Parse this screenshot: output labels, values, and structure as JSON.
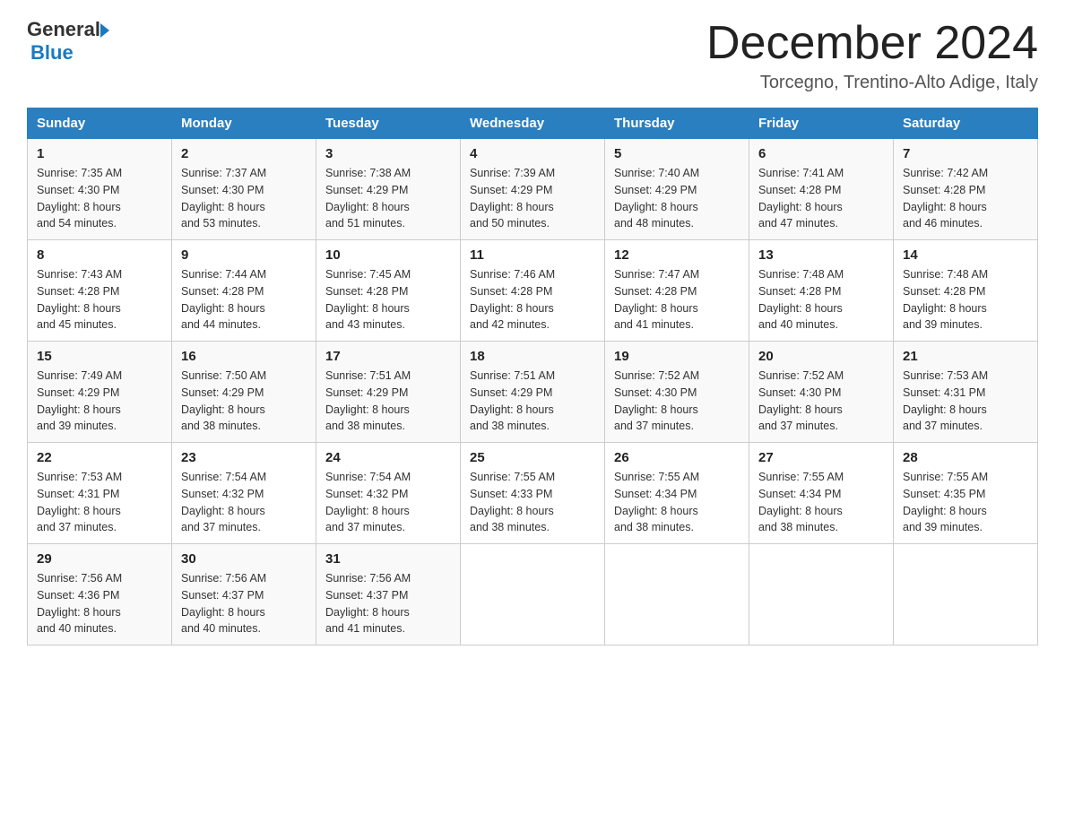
{
  "header": {
    "logo_general": "General",
    "logo_blue": "Blue",
    "month_title": "December 2024",
    "location": "Torcegno, Trentino-Alto Adige, Italy"
  },
  "days_of_week": [
    "Sunday",
    "Monday",
    "Tuesday",
    "Wednesday",
    "Thursday",
    "Friday",
    "Saturday"
  ],
  "weeks": [
    [
      {
        "day": "1",
        "sunrise": "7:35 AM",
        "sunset": "4:30 PM",
        "daylight": "8 hours and 54 minutes."
      },
      {
        "day": "2",
        "sunrise": "7:37 AM",
        "sunset": "4:30 PM",
        "daylight": "8 hours and 53 minutes."
      },
      {
        "day": "3",
        "sunrise": "7:38 AM",
        "sunset": "4:29 PM",
        "daylight": "8 hours and 51 minutes."
      },
      {
        "day": "4",
        "sunrise": "7:39 AM",
        "sunset": "4:29 PM",
        "daylight": "8 hours and 50 minutes."
      },
      {
        "day": "5",
        "sunrise": "7:40 AM",
        "sunset": "4:29 PM",
        "daylight": "8 hours and 48 minutes."
      },
      {
        "day": "6",
        "sunrise": "7:41 AM",
        "sunset": "4:28 PM",
        "daylight": "8 hours and 47 minutes."
      },
      {
        "day": "7",
        "sunrise": "7:42 AM",
        "sunset": "4:28 PM",
        "daylight": "8 hours and 46 minutes."
      }
    ],
    [
      {
        "day": "8",
        "sunrise": "7:43 AM",
        "sunset": "4:28 PM",
        "daylight": "8 hours and 45 minutes."
      },
      {
        "day": "9",
        "sunrise": "7:44 AM",
        "sunset": "4:28 PM",
        "daylight": "8 hours and 44 minutes."
      },
      {
        "day": "10",
        "sunrise": "7:45 AM",
        "sunset": "4:28 PM",
        "daylight": "8 hours and 43 minutes."
      },
      {
        "day": "11",
        "sunrise": "7:46 AM",
        "sunset": "4:28 PM",
        "daylight": "8 hours and 42 minutes."
      },
      {
        "day": "12",
        "sunrise": "7:47 AM",
        "sunset": "4:28 PM",
        "daylight": "8 hours and 41 minutes."
      },
      {
        "day": "13",
        "sunrise": "7:48 AM",
        "sunset": "4:28 PM",
        "daylight": "8 hours and 40 minutes."
      },
      {
        "day": "14",
        "sunrise": "7:48 AM",
        "sunset": "4:28 PM",
        "daylight": "8 hours and 39 minutes."
      }
    ],
    [
      {
        "day": "15",
        "sunrise": "7:49 AM",
        "sunset": "4:29 PM",
        "daylight": "8 hours and 39 minutes."
      },
      {
        "day": "16",
        "sunrise": "7:50 AM",
        "sunset": "4:29 PM",
        "daylight": "8 hours and 38 minutes."
      },
      {
        "day": "17",
        "sunrise": "7:51 AM",
        "sunset": "4:29 PM",
        "daylight": "8 hours and 38 minutes."
      },
      {
        "day": "18",
        "sunrise": "7:51 AM",
        "sunset": "4:29 PM",
        "daylight": "8 hours and 38 minutes."
      },
      {
        "day": "19",
        "sunrise": "7:52 AM",
        "sunset": "4:30 PM",
        "daylight": "8 hours and 37 minutes."
      },
      {
        "day": "20",
        "sunrise": "7:52 AM",
        "sunset": "4:30 PM",
        "daylight": "8 hours and 37 minutes."
      },
      {
        "day": "21",
        "sunrise": "7:53 AM",
        "sunset": "4:31 PM",
        "daylight": "8 hours and 37 minutes."
      }
    ],
    [
      {
        "day": "22",
        "sunrise": "7:53 AM",
        "sunset": "4:31 PM",
        "daylight": "8 hours and 37 minutes."
      },
      {
        "day": "23",
        "sunrise": "7:54 AM",
        "sunset": "4:32 PM",
        "daylight": "8 hours and 37 minutes."
      },
      {
        "day": "24",
        "sunrise": "7:54 AM",
        "sunset": "4:32 PM",
        "daylight": "8 hours and 37 minutes."
      },
      {
        "day": "25",
        "sunrise": "7:55 AM",
        "sunset": "4:33 PM",
        "daylight": "8 hours and 38 minutes."
      },
      {
        "day": "26",
        "sunrise": "7:55 AM",
        "sunset": "4:34 PM",
        "daylight": "8 hours and 38 minutes."
      },
      {
        "day": "27",
        "sunrise": "7:55 AM",
        "sunset": "4:34 PM",
        "daylight": "8 hours and 38 minutes."
      },
      {
        "day": "28",
        "sunrise": "7:55 AM",
        "sunset": "4:35 PM",
        "daylight": "8 hours and 39 minutes."
      }
    ],
    [
      {
        "day": "29",
        "sunrise": "7:56 AM",
        "sunset": "4:36 PM",
        "daylight": "8 hours and 40 minutes."
      },
      {
        "day": "30",
        "sunrise": "7:56 AM",
        "sunset": "4:37 PM",
        "daylight": "8 hours and 40 minutes."
      },
      {
        "day": "31",
        "sunrise": "7:56 AM",
        "sunset": "4:37 PM",
        "daylight": "8 hours and 41 minutes."
      },
      null,
      null,
      null,
      null
    ]
  ],
  "labels": {
    "sunrise": "Sunrise:",
    "sunset": "Sunset:",
    "daylight": "Daylight:"
  }
}
